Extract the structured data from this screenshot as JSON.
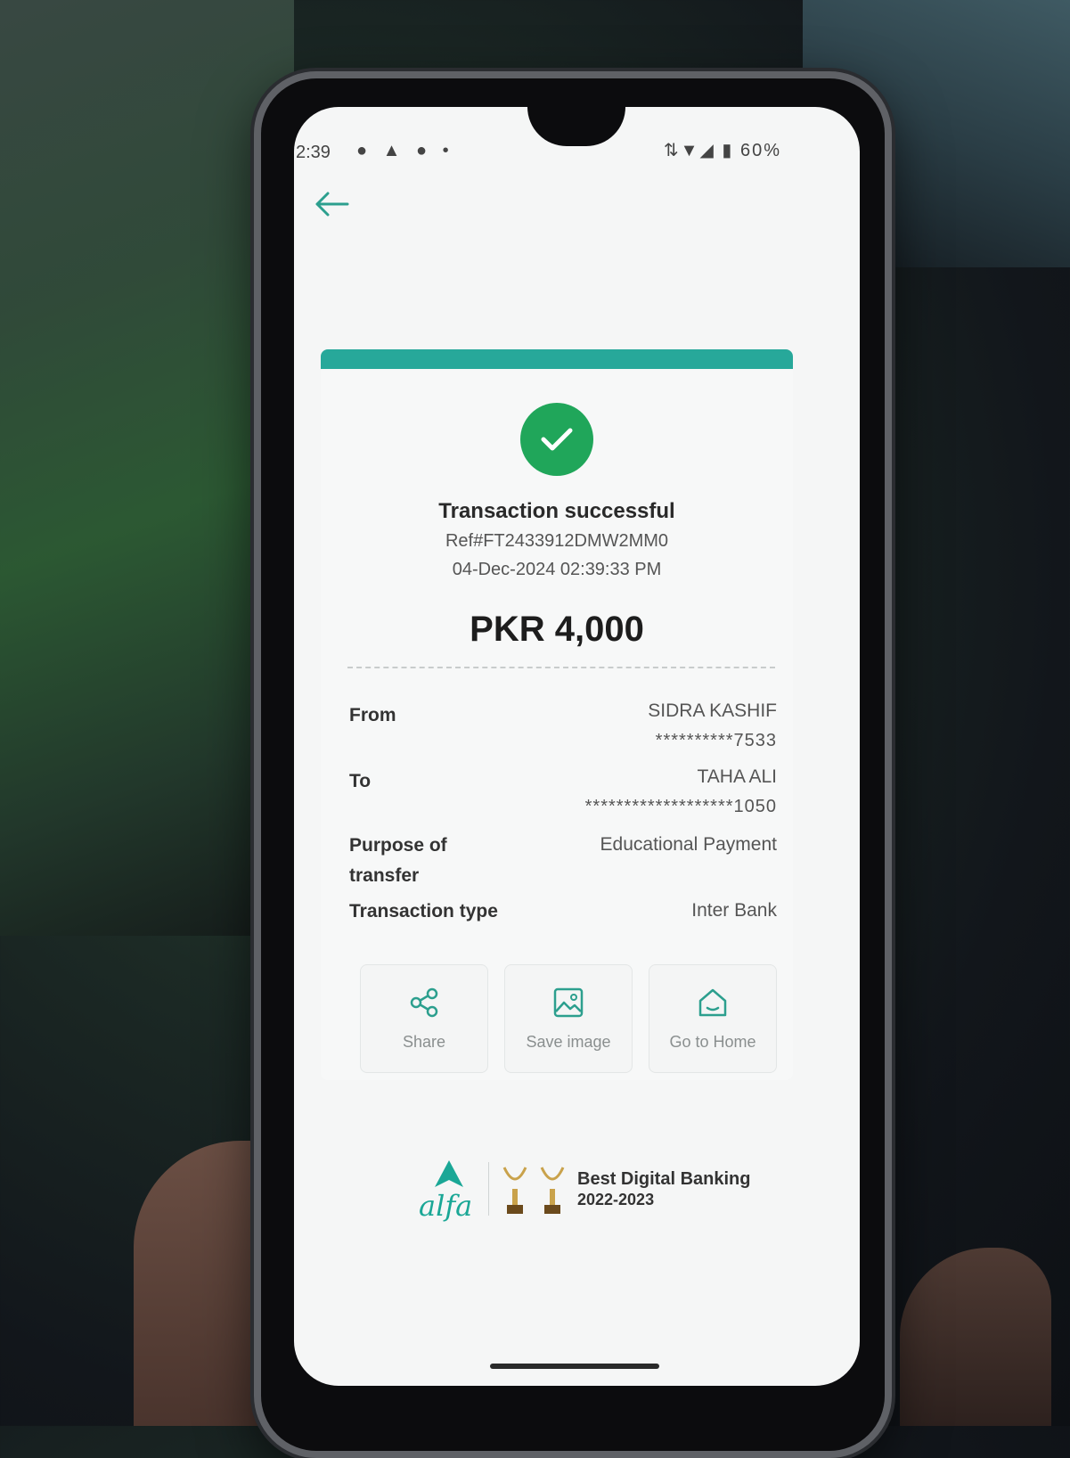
{
  "status_bar": {
    "time": "2:39",
    "notification_icons": "● ▲ ● •",
    "signal_icons": "⇅▼◢",
    "battery": "60%"
  },
  "receipt": {
    "title": "Transaction successful",
    "reference": "Ref#FT2433912DMW2MM0",
    "datetime": "04-Dec-2024 02:39:33 PM",
    "amount": "PKR 4,000",
    "rows": [
      {
        "label": "From",
        "value": "SIDRA KASHIF",
        "sub": "**********7533"
      },
      {
        "label": "To",
        "value": "TAHA ALI",
        "sub": "*******************1050"
      },
      {
        "label": "Purpose of transfer",
        "value": "Educational Payment"
      },
      {
        "label": "Transaction type",
        "value": "Inter Bank"
      }
    ],
    "accent_color": "#27a89a",
    "success_color": "#20a65a"
  },
  "actions": [
    {
      "label": "Share",
      "icon": "share-icon"
    },
    {
      "label": "Save image",
      "icon": "image-icon"
    },
    {
      "label": "Go to Home",
      "icon": "home-icon"
    }
  ],
  "footer": {
    "brand": "alfa",
    "award_title": "Best Digital Banking",
    "award_year": "2022-2023"
  }
}
